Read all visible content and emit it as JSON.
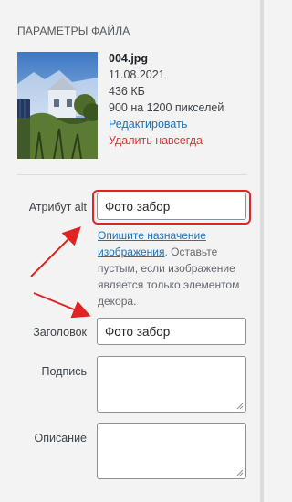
{
  "section_title": "ПАРАМЕТРЫ ФАЙЛА",
  "file": {
    "name": "004.jpg",
    "date": "11.08.2021",
    "size": "436 КБ",
    "dimensions": "900 на 1200 пикселей",
    "edit_link": "Редактировать",
    "delete_link": "Удалить навсегда"
  },
  "fields": {
    "alt": {
      "label": "Атрибут alt",
      "value": "Фото забор"
    },
    "help": {
      "link": "Опишите назначение изображения",
      "text": ". Оставьте пустым, если изображение является только элементом декора."
    },
    "title": {
      "label": "Заголовок",
      "value": "Фото забор"
    },
    "caption": {
      "label": "Подпись",
      "value": ""
    },
    "description": {
      "label": "Описание",
      "value": ""
    }
  },
  "colors": {
    "link": "#2271b1",
    "delete": "#d63638",
    "annotation": "#e02424"
  }
}
